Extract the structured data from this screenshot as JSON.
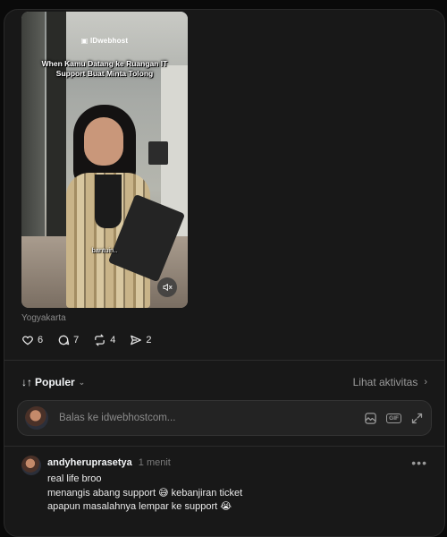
{
  "video": {
    "logo": "IDwebhost",
    "caption": "When Kamu Datang ke Ruangan IT Support Buat Minta Tolong",
    "subtitle": "bantuin.."
  },
  "post": {
    "location": "Yogyakarta",
    "likes": "6",
    "comments": "7",
    "reposts": "4",
    "shares": "2"
  },
  "sort": {
    "label": "Populer",
    "activity_link": "Lihat aktivitas"
  },
  "reply": {
    "placeholder": "Balas ke idwebhostcom...",
    "gif_label": "GIF"
  },
  "comment": {
    "username": "andyheruprasetya",
    "time": "1 menit",
    "more": "•••",
    "lines": [
      "real life broo",
      "menangis abang support 😅 kebanjiran ticket",
      "apapun masalahnya lempar ke support 😭"
    ]
  }
}
